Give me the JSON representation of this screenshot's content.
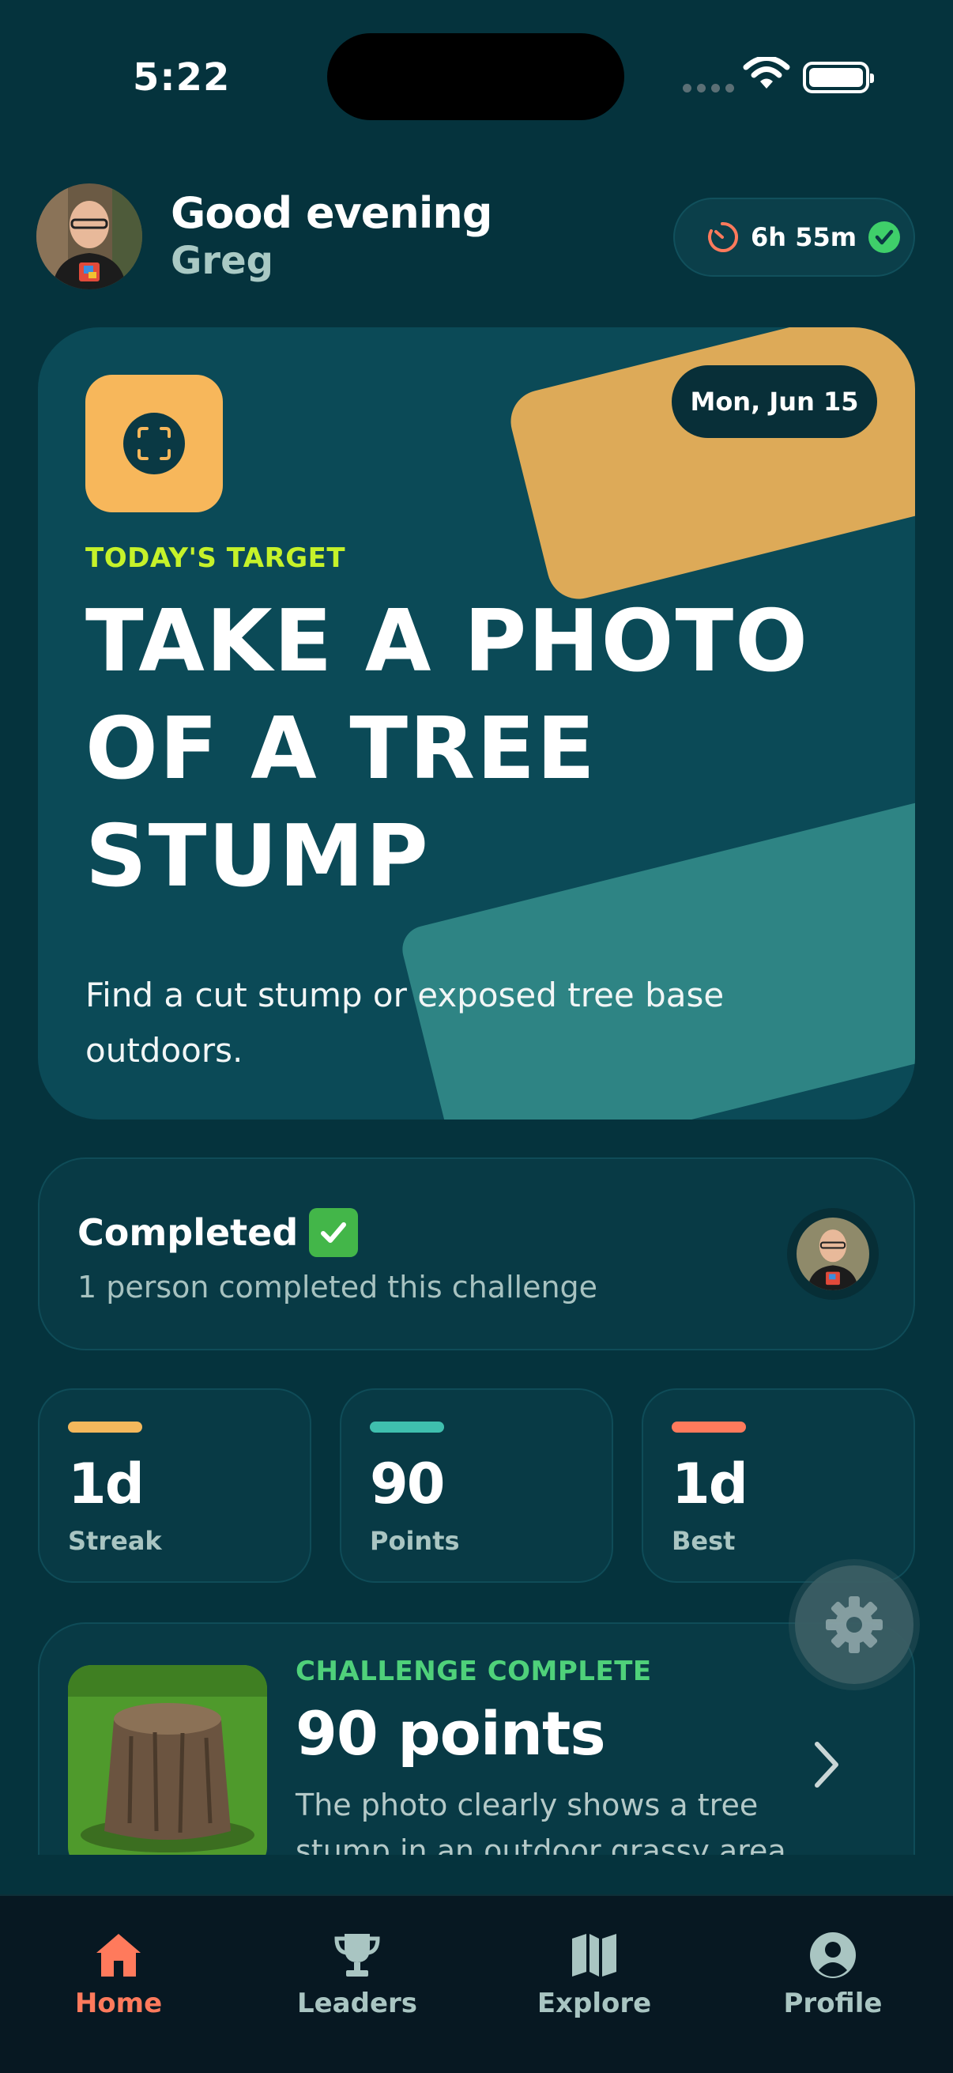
{
  "status_bar": {
    "time": "5:22"
  },
  "header": {
    "greeting": "Good evening",
    "username": "Greg",
    "timer": "6h 55m"
  },
  "hero": {
    "date": "Mon, Jun 15",
    "label": "TODAY'S TARGET",
    "title": "TAKE A PHOTO OF A TREE STUMP",
    "description": "Find a cut stump or exposed tree base outdoors."
  },
  "completed": {
    "title": "Completed",
    "subtitle": "1 person completed this challenge"
  },
  "stats": [
    {
      "value": "1d",
      "label": "Streak",
      "color": "#f4b85c"
    },
    {
      "value": "90",
      "label": "Points",
      "color": "#3fbfae"
    },
    {
      "value": "1d",
      "label": "Best",
      "color": "#ff7a5c"
    }
  ],
  "result": {
    "label": "CHALLENGE COMPLETE",
    "points": "90 points",
    "description": "The photo clearly shows a tree stump in an outdoor grassy area"
  },
  "tabs": [
    {
      "label": "Home",
      "icon": "home-icon",
      "active": true
    },
    {
      "label": "Leaders",
      "icon": "trophy-icon",
      "active": false
    },
    {
      "label": "Explore",
      "icon": "map-icon",
      "active": false
    },
    {
      "label": "Profile",
      "icon": "profile-icon",
      "active": false
    }
  ],
  "colors": {
    "background": "#05333d",
    "accent": "#ff7a5c",
    "gold": "#ddaa58",
    "lime": "#c6f22a",
    "success": "#4fd17a"
  }
}
